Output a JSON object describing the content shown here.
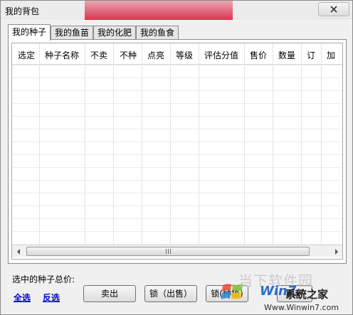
{
  "window": {
    "title": "我的背包",
    "close_icon": "close-x-icon"
  },
  "tabs": [
    {
      "label": "我的种子",
      "active": true
    },
    {
      "label": "我的鱼苗",
      "active": false
    },
    {
      "label": "我的化肥",
      "active": false
    },
    {
      "label": "我的鱼食",
      "active": false
    }
  ],
  "grid": {
    "columns": [
      "选定",
      "种子名称",
      "不卖",
      "不种",
      "点亮",
      "等级",
      "评估分值",
      "售价",
      "数量",
      "订",
      "加"
    ],
    "rows": []
  },
  "scrollbar": {
    "left_arrow_icon": "scroll-left-arrow-icon",
    "right_arrow_icon": "scroll-right-arrow-icon"
  },
  "footer": {
    "total_label": "选中的种子总价:",
    "select_all": "全选",
    "invert_select": "反选",
    "sell_button": "卖出",
    "lock_sell_button": "锁（出售）",
    "lock_plant_button": "锁(种植)",
    "refresh_button": "刷新"
  },
  "watermark": {
    "line1": "当下软件园",
    "brand": "Win7",
    "brand_suffix": "系统之家",
    "url": "Www.Winwin7.com"
  },
  "colors": {
    "title_band": "#d9364e",
    "link": "#0000cc",
    "watermark_blue": "#2d6ec7"
  }
}
